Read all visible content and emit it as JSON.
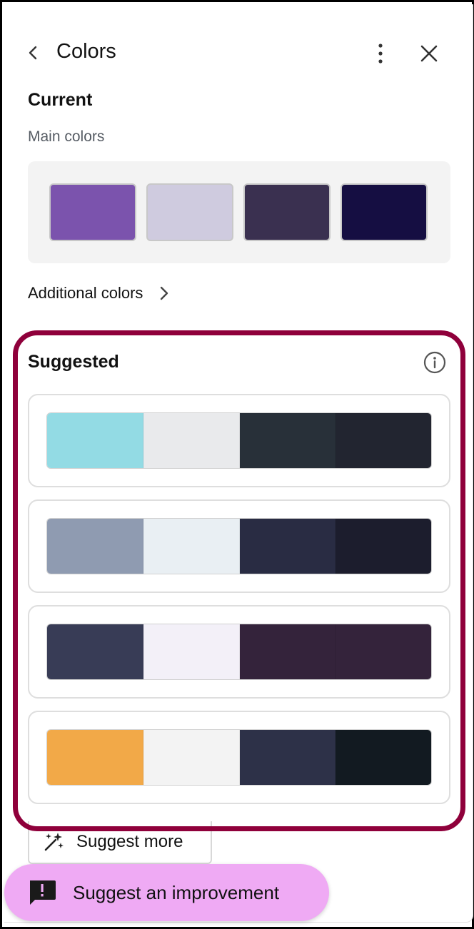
{
  "header": {
    "title": "Colors"
  },
  "current": {
    "title": "Current",
    "main_colors_label": "Main colors",
    "main_colors": [
      "#7b53ad",
      "#cfcbdf",
      "#3a3050",
      "#150e42"
    ],
    "additional_colors_label": "Additional colors"
  },
  "suggested": {
    "title": "Suggested",
    "palettes": [
      {
        "colors": [
          "#93dbe4",
          "#e9eaec",
          "#283039",
          "#222530"
        ]
      },
      {
        "colors": [
          "#8f9bb1",
          "#e9eff3",
          "#292c43",
          "#1c1d2d"
        ]
      },
      {
        "colors": [
          "#383c56",
          "#f3f0f8",
          "#34233b",
          "#34233b"
        ]
      },
      {
        "colors": [
          "#f2a948",
          "#f3f3f3",
          "#2d3148",
          "#121a21"
        ]
      }
    ],
    "suggest_more_label": "Suggest more"
  },
  "fab": {
    "label": "Suggest an improvement"
  },
  "colors": {
    "highlight": "#8f003b",
    "fab_bg": "#efaaf4"
  }
}
